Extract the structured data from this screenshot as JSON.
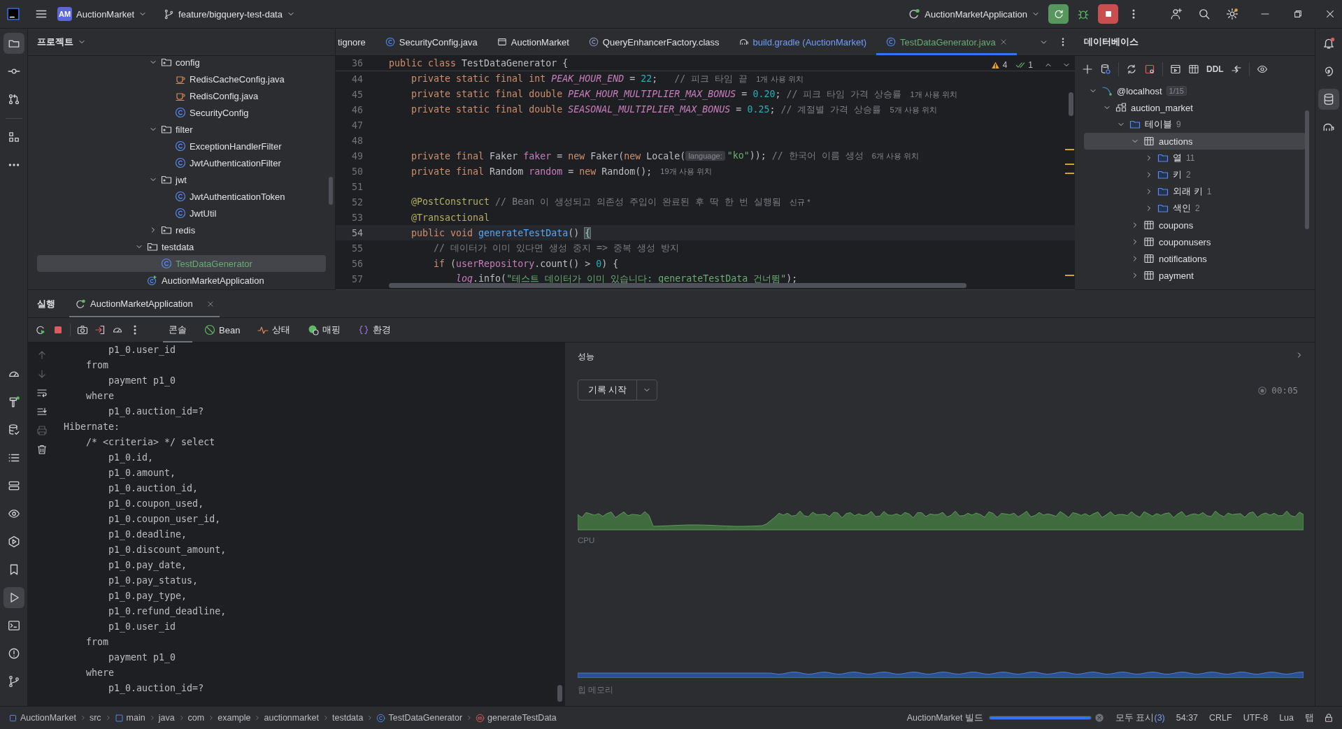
{
  "title_bar": {
    "project_badge": "AM",
    "project": "AuctionMarket",
    "branch": "feature/bigquery-test-data",
    "run_config": "AuctionMarketApplication"
  },
  "project_panel": {
    "title": "프로젝트",
    "tree": [
      {
        "kind": "group",
        "children": [
          {
            "kind": "folder",
            "label": "config",
            "expanded": true,
            "selected": false,
            "added": false,
            "children": [
              {
                "kind": "java",
                "label": "RedisCacheConfig.java",
                "selected": false,
                "added": false
              },
              {
                "kind": "java",
                "label": "RedisConfig.java",
                "selected": false,
                "added": false
              },
              {
                "kind": "class",
                "label": "SecurityConfig",
                "selected": false,
                "added": false
              }
            ]
          },
          {
            "kind": "folder",
            "label": "filter",
            "expanded": true,
            "selected": false,
            "added": false,
            "children": [
              {
                "kind": "class",
                "label": "ExceptionHandlerFilter",
                "selected": false,
                "added": false
              },
              {
                "kind": "class",
                "label": "JwtAuthenticationFilter",
                "selected": false,
                "added": false
              }
            ]
          },
          {
            "kind": "folder",
            "label": "jwt",
            "expanded": true,
            "selected": false,
            "added": false,
            "children": [
              {
                "kind": "class",
                "label": "JwtAuthenticationToken",
                "selected": false,
                "added": false
              },
              {
                "kind": "class",
                "label": "JwtUtil",
                "selected": false,
                "added": false
              }
            ]
          },
          {
            "kind": "folder",
            "label": "redis",
            "expanded": false,
            "selected": false,
            "added": false
          }
        ]
      },
      {
        "kind": "folder",
        "label": "testdata",
        "expanded": true,
        "selected": false,
        "added": false,
        "children": [
          {
            "kind": "class",
            "label": "TestDataGenerator",
            "selected": true,
            "added": true
          }
        ]
      },
      {
        "kind": "app",
        "label": "AuctionMarketApplication",
        "selected": false,
        "added": false
      }
    ]
  },
  "editor": {
    "tabs": [
      {
        "kind": "text",
        "label": "tignore",
        "selected": false,
        "added": false,
        "modified": false
      },
      {
        "kind": "class",
        "label": "SecurityConfig.java",
        "selected": false,
        "added": false,
        "modified": false
      },
      {
        "kind": "module",
        "label": "AuctionMarket",
        "selected": false,
        "added": false,
        "modified": false
      },
      {
        "kind": "class_file",
        "label": "QueryEnhancerFactory.class",
        "selected": false,
        "added": false,
        "modified": false
      },
      {
        "kind": "gradle",
        "label": "build.gradle (AuctionMarket)",
        "selected": false,
        "added": false,
        "modified": true
      },
      {
        "kind": "class",
        "label": "TestDataGenerator.java",
        "selected": true,
        "added": true,
        "modified": false
      }
    ],
    "warnings": "4",
    "checks": "1",
    "sticky_line": {
      "number": "36",
      "tokens": [
        {
          "kind": "kw",
          "text": "public class "
        },
        {
          "kind": "plain",
          "text": "TestDataGenerator {"
        }
      ]
    },
    "lines": [
      {
        "number": "44",
        "current": false,
        "tokens": [
          {
            "kind": "kw",
            "text": "    private static final int "
          },
          {
            "kind": "const",
            "text": "PEAK_HOUR_END"
          },
          {
            "kind": "plain",
            "text": " = "
          },
          {
            "kind": "num",
            "text": "22"
          },
          {
            "kind": "plain",
            "text": ";   "
          },
          {
            "kind": "comment",
            "text": "// 피크 타임 끝"
          },
          {
            "kind": "hint",
            "text": "1개 사용 위치"
          }
        ]
      },
      {
        "number": "45",
        "current": false,
        "tokens": [
          {
            "kind": "kw",
            "text": "    private static final double "
          },
          {
            "kind": "const",
            "text": "PEAK_HOUR_MULTIPLIER_MAX_BONUS"
          },
          {
            "kind": "plain",
            "text": " = "
          },
          {
            "kind": "num",
            "text": "0.20"
          },
          {
            "kind": "plain",
            "text": "; "
          },
          {
            "kind": "comment",
            "text": "// 피크 타임 가격 상승률"
          },
          {
            "kind": "hint",
            "text": "1개 사용 위치"
          }
        ]
      },
      {
        "number": "46",
        "current": false,
        "tokens": [
          {
            "kind": "kw",
            "text": "    private static final double "
          },
          {
            "kind": "const",
            "text": "SEASONAL_MULTIPLIER_MAX_BONUS"
          },
          {
            "kind": "plain",
            "text": " = "
          },
          {
            "kind": "num",
            "text": "0.25"
          },
          {
            "kind": "plain",
            "text": "; "
          },
          {
            "kind": "comment",
            "text": "// 계절별 가격 상승률"
          },
          {
            "kind": "hint",
            "text": "5개 사용 위치"
          }
        ]
      },
      {
        "number": "47",
        "current": false
      },
      {
        "number": "48",
        "current": false
      },
      {
        "number": "49",
        "current": false,
        "tokens": [
          {
            "kind": "kw",
            "text": "    private final "
          },
          {
            "kind": "plain",
            "text": "Faker "
          },
          {
            "kind": "field",
            "text": "faker"
          },
          {
            "kind": "plain",
            "text": " = "
          },
          {
            "kind": "kw",
            "text": "new "
          },
          {
            "kind": "plain",
            "text": "Faker("
          },
          {
            "kind": "kw",
            "text": "new "
          },
          {
            "kind": "plain",
            "text": "Locale("
          },
          {
            "kind": "inlay",
            "text": "language:"
          },
          {
            "kind": "string",
            "text": "\"ko\""
          },
          {
            "kind": "plain",
            "text": ")); "
          },
          {
            "kind": "comment",
            "text": "// 한국어 이름 생성"
          },
          {
            "kind": "hint",
            "text": "6개 사용 위치"
          }
        ]
      },
      {
        "number": "50",
        "current": false,
        "tokens": [
          {
            "kind": "kw",
            "text": "    private final "
          },
          {
            "kind": "plain",
            "text": "Random "
          },
          {
            "kind": "field",
            "text": "random"
          },
          {
            "kind": "plain",
            "text": " = "
          },
          {
            "kind": "kw",
            "text": "new "
          },
          {
            "kind": "plain",
            "text": "Random();"
          },
          {
            "kind": "hint",
            "text": "19개 사용 위치"
          }
        ]
      },
      {
        "number": "51",
        "current": false
      },
      {
        "number": "52",
        "current": false,
        "tokens": [
          {
            "kind": "annot",
            "text": "    @PostConstruct"
          },
          {
            "kind": "comment",
            "text": " // Bean 이 생성되고 의존성 주입이 완료된 후 딱 한 번 실행됨"
          },
          {
            "kind": "hint",
            "text": "신규 *"
          }
        ]
      },
      {
        "number": "53",
        "current": false,
        "tokens": [
          {
            "kind": "annot",
            "text": "    @Transactional"
          }
        ]
      },
      {
        "number": "54",
        "current": true,
        "tokens": [
          {
            "kind": "kw",
            "text": "    public void "
          },
          {
            "kind": "method",
            "text": "generateTestData"
          },
          {
            "kind": "plain",
            "text": "() "
          },
          {
            "kind": "brace",
            "text": "{"
          }
        ]
      },
      {
        "number": "55",
        "current": false,
        "tokens": [
          {
            "kind": "comment",
            "text": "        // 데이터가 이미 있다면 생성 중지 => 중복 생성 방지"
          }
        ]
      },
      {
        "number": "56",
        "current": false,
        "tokens": [
          {
            "kind": "kw",
            "text": "        if "
          },
          {
            "kind": "plain",
            "text": "("
          },
          {
            "kind": "field",
            "text": "userRepository"
          },
          {
            "kind": "plain",
            "text": ".count() > "
          },
          {
            "kind": "num",
            "text": "0"
          },
          {
            "kind": "plain",
            "text": ") {"
          }
        ]
      },
      {
        "number": "57",
        "current": false,
        "tokens": [
          {
            "kind": "static",
            "text": "            log"
          },
          {
            "kind": "plain",
            "text": ".info("
          },
          {
            "kind": "string",
            "text": "\"테스트 데이터가 이미 있습니다: generateTestData 건너뜀\""
          },
          {
            "kind": "plain",
            "text": ");"
          }
        ]
      }
    ]
  },
  "database": {
    "title": "데이터베이스",
    "ddl_button": "DDL",
    "tree": [
      {
        "kind": "host",
        "label": "@localhost",
        "badge": "1/15",
        "expanded": true,
        "selected": false,
        "children": [
          {
            "kind": "schema",
            "label": "auction_market",
            "expanded": true,
            "selected": false,
            "children": [
              {
                "kind": "folder",
                "label": "테이블",
                "count": "9",
                "expanded": true,
                "selected": false,
                "children": [
                  {
                    "kind": "table",
                    "label": "auctions",
                    "expanded": true,
                    "selected": true,
                    "children": [
                      {
                        "kind": "folder",
                        "label": "열",
                        "count": "11",
                        "expanded": false,
                        "selected": false
                      },
                      {
                        "kind": "folder",
                        "label": "키",
                        "count": "2",
                        "expanded": false,
                        "selected": false
                      },
                      {
                        "kind": "folder",
                        "label": "외래 키",
                        "count": "1",
                        "expanded": false,
                        "selected": false
                      },
                      {
                        "kind": "folder",
                        "label": "색인",
                        "count": "2",
                        "expanded": false,
                        "selected": false
                      }
                    ]
                  },
                  {
                    "kind": "table",
                    "label": "coupons",
                    "expanded": false,
                    "selected": false
                  },
                  {
                    "kind": "table",
                    "label": "couponusers",
                    "expanded": false,
                    "selected": false
                  },
                  {
                    "kind": "table",
                    "label": "notifications",
                    "expanded": false,
                    "selected": false
                  },
                  {
                    "kind": "table",
                    "label": "payment",
                    "expanded": false,
                    "selected": false
                  }
                ]
              }
            ]
          }
        ]
      }
    ]
  },
  "run_panel": {
    "title": "실행",
    "tabs": [
      {
        "label": "AuctionMarketApplication",
        "selected": true
      }
    ],
    "views": [
      {
        "kind": "console",
        "label": "콘솔",
        "selected": true
      },
      {
        "kind": "bean",
        "label": "Bean",
        "selected": false
      },
      {
        "kind": "health",
        "label": "상태",
        "selected": false
      },
      {
        "kind": "mapping",
        "label": "매핑",
        "selected": false
      },
      {
        "kind": "env",
        "label": "환경",
        "selected": false
      }
    ],
    "console": [
      "        p1_0.user_id",
      "    from",
      "        payment p1_0",
      "    where",
      "        p1_0.auction_id=?",
      "Hibernate:",
      "    /* <criteria> */ select",
      "        p1_0.id,",
      "        p1_0.amount,",
      "        p1_0.auction_id,",
      "        p1_0.coupon_used,",
      "        p1_0.coupon_user_id,",
      "        p1_0.deadline,",
      "        p1_0.discount_amount,",
      "        p1_0.pay_date,",
      "        p1_0.pay_status,",
      "        p1_0.pay_type,",
      "        p1_0.refund_deadline,",
      "        p1_0.user_id",
      "    from",
      "        payment p1_0",
      "    where",
      "        p1_0.auction_id=?"
    ],
    "performance": {
      "title": "성능",
      "record_button": "기록 시작",
      "elapsed": "00:05",
      "cpu_label": "CPU",
      "memory_label": "힙 메모리"
    }
  },
  "status_bar": {
    "breadcrumbs": [
      {
        "kind": "module",
        "label": "AuctionMarket"
      },
      {
        "kind": "text",
        "label": "src"
      },
      {
        "kind": "source",
        "label": "main"
      },
      {
        "kind": "text",
        "label": "java"
      },
      {
        "kind": "text",
        "label": "com"
      },
      {
        "kind": "text",
        "label": "example"
      },
      {
        "kind": "text",
        "label": "auctionmarket"
      },
      {
        "kind": "text",
        "label": "testdata"
      },
      {
        "kind": "class",
        "label": "TestDataGenerator"
      },
      {
        "kind": "method",
        "label": "generateTestData"
      }
    ],
    "build": {
      "label": "AuctionMarket 빌드",
      "level": 1
    },
    "show_all": "모두 표시",
    "show_all_count": "(3)",
    "position": "54:37",
    "line_ending": "CRLF",
    "encoding": "UTF-8",
    "language": "Lua",
    "indent": "탭"
  }
}
